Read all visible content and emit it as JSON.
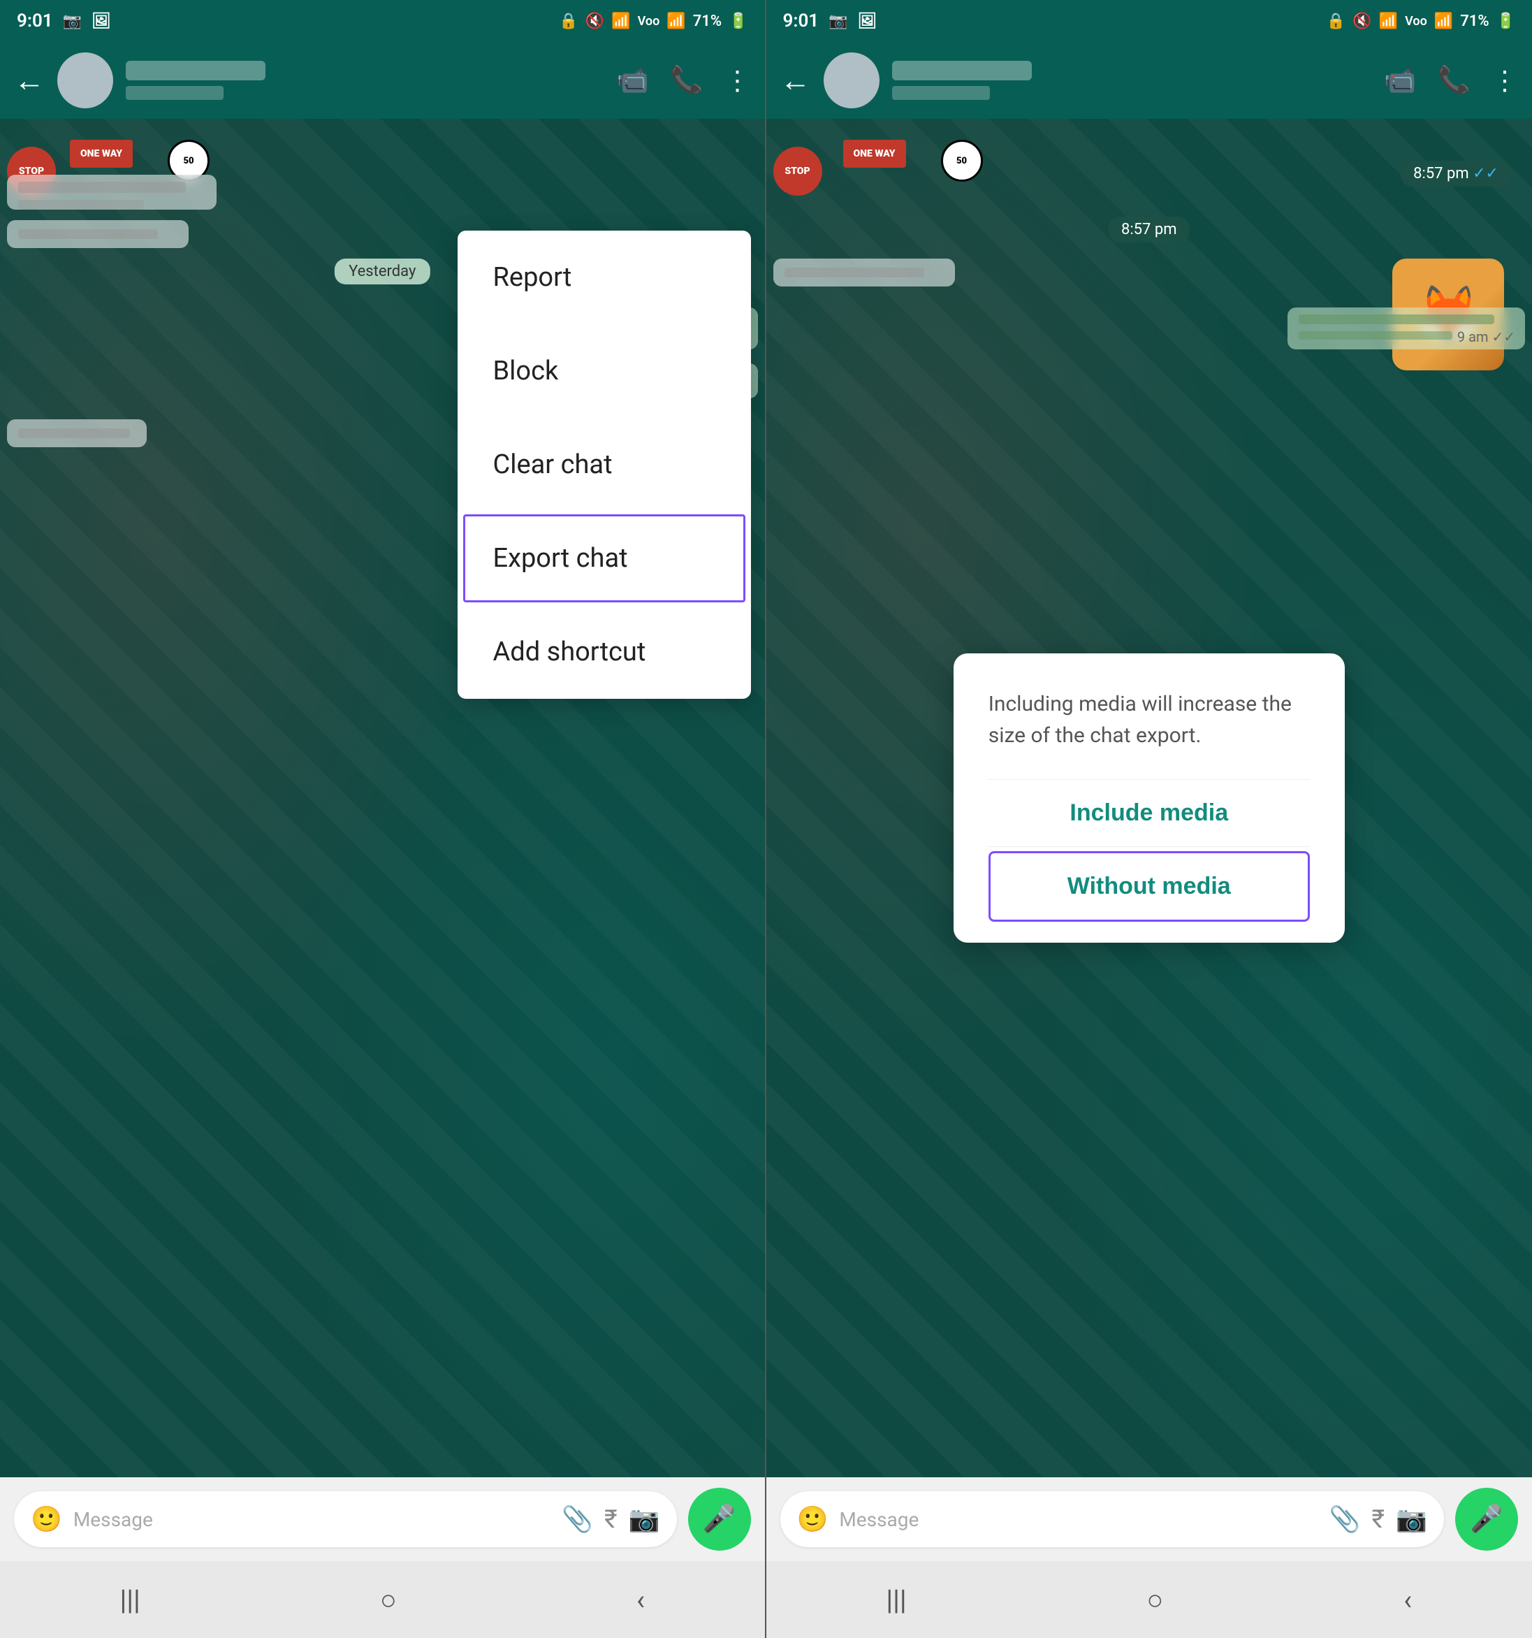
{
  "left": {
    "statusBar": {
      "time": "9:01",
      "icons": [
        "instagram",
        "gallery",
        "battery_lock",
        "no_sound",
        "wifi",
        "vol",
        "signal",
        "percent"
      ],
      "battery": "71%"
    },
    "topBar": {
      "contactName": "●●●●●●●●●●",
      "backLabel": "←"
    },
    "dropdown": {
      "items": [
        {
          "label": "Report",
          "highlighted": false
        },
        {
          "label": "Block",
          "highlighted": false
        },
        {
          "label": "Clear chat",
          "highlighted": false
        },
        {
          "label": "Export chat",
          "highlighted": true
        },
        {
          "label": "Add shortcut",
          "highlighted": false
        }
      ]
    },
    "chat": {
      "dateBadge": "Yesterday"
    },
    "bottomBar": {
      "placeholder": "Message",
      "micIcon": "🎤"
    },
    "navBar": {
      "icons": [
        "|||",
        "○",
        "<"
      ]
    }
  },
  "right": {
    "statusBar": {
      "time": "9:01",
      "battery": "71%"
    },
    "topBar": {
      "contactName": "●●●●●●●●●●",
      "backLabel": "←"
    },
    "chat": {
      "timeBadge1": "8:57 pm",
      "timeBadge2": "8:57 pm"
    },
    "dialog": {
      "message": "Including media will increase the size of the chat export.",
      "includeMedia": "Include media",
      "withoutMedia": "Without media"
    },
    "bottomBar": {
      "placeholder": "Message",
      "micIcon": "🎤"
    },
    "navBar": {
      "icons": [
        "|||",
        "○",
        "<"
      ]
    }
  }
}
